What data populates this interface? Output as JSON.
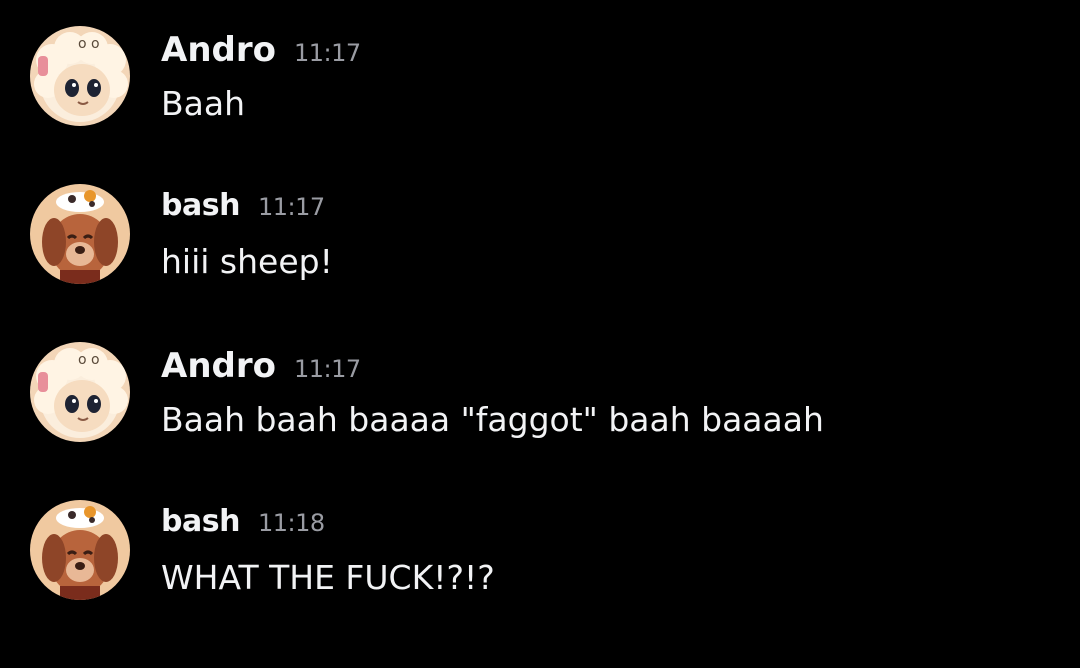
{
  "messages": [
    {
      "author": "Andro",
      "avatar_icon": "sheep-avatar-icon",
      "timestamp": "11:17",
      "text": "Baah"
    },
    {
      "author": "bash",
      "avatar_icon": "dog-with-cow-hat-avatar-icon",
      "timestamp": "11:17",
      "text": "hiii sheep!"
    },
    {
      "author": "Andro",
      "avatar_icon": "sheep-avatar-icon",
      "timestamp": "11:17",
      "text": "Baah baah baaaa \"faggot\" baah baaaah"
    },
    {
      "author": "bash",
      "avatar_icon": "dog-with-cow-hat-avatar-icon",
      "timestamp": "11:18",
      "text": "WHAT THE FUCK!?!?"
    }
  ],
  "colors": {
    "background": "#000000",
    "text": "#f2f3f5",
    "timestamp": "#9a9ca3"
  }
}
